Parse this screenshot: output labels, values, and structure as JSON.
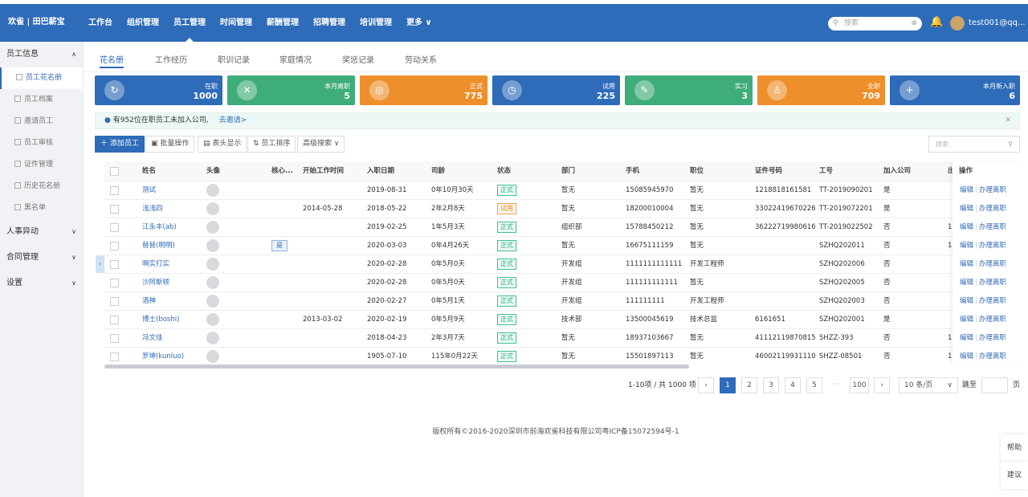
{
  "header": {
    "logo": "欢雀 | 田巴薪宝",
    "nav": [
      "工作台",
      "组织管理",
      "员工管理",
      "时间管理",
      "薪酬管理",
      "招聘管理",
      "培训管理",
      "更多"
    ],
    "search_placeholder": "搜索",
    "user": "test001@qq..."
  },
  "sidebar": {
    "groups": [
      {
        "label": "员工信息",
        "items": [
          "员工花名册",
          "员工档案",
          "邀请员工",
          "员工审核",
          "证件管理",
          "历史花名册",
          "黑名单"
        ]
      },
      {
        "label": "人事异动"
      },
      {
        "label": "合同管理"
      },
      {
        "label": "设置"
      }
    ]
  },
  "tabs": [
    "花名册",
    "工作经历",
    "职训记录",
    "家庭情况",
    "奖惩记录",
    "劳动关系"
  ],
  "cards": [
    {
      "label": "在职",
      "value": "1000",
      "color": "#2e6bb8",
      "icon": "↻"
    },
    {
      "label": "本月离职",
      "value": "5",
      "color": "#3fad7a",
      "icon": "✕"
    },
    {
      "label": "正式",
      "value": "775",
      "color": "#ed8f2b",
      "icon": "◎"
    },
    {
      "label": "试用",
      "value": "225",
      "color": "#2e6bb8",
      "icon": "◷"
    },
    {
      "label": "实习",
      "value": "3",
      "color": "#3fad7a",
      "icon": "✎"
    },
    {
      "label": "全职",
      "value": "709",
      "color": "#ed8f2b",
      "icon": "♙"
    },
    {
      "label": "本月新入职",
      "value": "6",
      "color": "#2e6bb8",
      "icon": "+"
    }
  ],
  "notice": {
    "text": "有952位在职员工未加入公司,",
    "link": "去邀请>"
  },
  "toolbar": {
    "add": "添加员工",
    "batch": "批量操作",
    "header_display": "表头显示",
    "sort": "员工排序",
    "advanced": "高级搜索",
    "search_placeholder": "搜索"
  },
  "table": {
    "columns": [
      "姓名",
      "头像",
      "核心...",
      "开始工作时间",
      "入职日期",
      "司龄",
      "状态",
      "部门",
      "手机",
      "职位",
      "证件号码",
      "工号",
      "加入公司",
      "出",
      "操作"
    ],
    "rows": [
      {
        "name": "测试",
        "core": "",
        "start": "",
        "join": "2019-08-31",
        "tenure": "0年10月30天",
        "status": "正式",
        "dept": "暂无",
        "phone": "15085945970",
        "pos": "暂无",
        "idno": "1218818161581",
        "emp": "TT-2019090201",
        "joined": "是",
        "extra": ""
      },
      {
        "name": "浅浅四",
        "core": "",
        "start": "2014-05-28",
        "join": "2018-05-22",
        "tenure": "2年2月8天",
        "status": "试用",
        "dept": "暂无",
        "phone": "18200010004",
        "pos": "暂无",
        "idno": "33022419670226...",
        "emp": "TT-2019072201",
        "joined": "是",
        "extra": ""
      },
      {
        "name": "江永丰(ab)",
        "core": "",
        "start": "",
        "join": "2019-02-25",
        "tenure": "1年5月3天",
        "status": "正式",
        "dept": "组织部",
        "phone": "15788450212",
        "pos": "暂无",
        "idno": "36222719980616...",
        "emp": "TT-2019022502",
        "joined": "否",
        "extra": "1"
      },
      {
        "name": "替替(明明)",
        "core": "是",
        "start": "",
        "join": "2020-03-03",
        "tenure": "0年4月26天",
        "status": "正式",
        "dept": "暂无",
        "phone": "16675111159",
        "pos": "暂无",
        "idno": "",
        "emp": "SZHQ202011",
        "joined": "否",
        "extra": "1"
      },
      {
        "name": "啊实打实",
        "core": "",
        "start": "",
        "join": "2020-02-28",
        "tenure": "0年5月0天",
        "status": "正式",
        "dept": "开发组",
        "phone": "1111111111111",
        "pos": "开发工程师",
        "idno": "",
        "emp": "SZHQ202006",
        "joined": "否",
        "extra": ""
      },
      {
        "name": "沙阿斯顿",
        "core": "",
        "start": "",
        "join": "2020-02-28",
        "tenure": "0年5月0天",
        "status": "正式",
        "dept": "开发组",
        "phone": "111111111111",
        "pos": "暂无",
        "idno": "",
        "emp": "SZHQ202005",
        "joined": "否",
        "extra": ""
      },
      {
        "name": "酒神",
        "core": "",
        "start": "",
        "join": "2020-02-27",
        "tenure": "0年5月1天",
        "status": "正式",
        "dept": "开发组",
        "phone": "111111111",
        "pos": "开发工程师",
        "idno": "",
        "emp": "SZHQ202003",
        "joined": "否",
        "extra": ""
      },
      {
        "name": "博士(boshi)",
        "core": "",
        "start": "2013-03-02",
        "join": "2020-02-19",
        "tenure": "0年5月9天",
        "status": "正式",
        "dept": "技术部",
        "phone": "13500045619",
        "pos": "技术总监",
        "idno": "6161651",
        "emp": "SZHQ202001",
        "joined": "是",
        "extra": ""
      },
      {
        "name": "冯文佳",
        "core": "",
        "start": "",
        "join": "2018-04-23",
        "tenure": "2年3月7天",
        "status": "正式",
        "dept": "暂无",
        "phone": "18937103667",
        "pos": "暂无",
        "idno": "41112119870815...",
        "emp": "SHZZ-393",
        "joined": "否",
        "extra": "1"
      },
      {
        "name": "罗坤(kunluo)",
        "core": "",
        "start": "",
        "join": "1905-07-10",
        "tenure": "115年0月22天",
        "status": "正式",
        "dept": "暂无",
        "phone": "15501897113",
        "pos": "暂无",
        "idno": "46002119931110...",
        "emp": "SHZZ-08501",
        "joined": "否",
        "extra": "1"
      }
    ],
    "op_edit": "编辑",
    "op_leave": "办理离职"
  },
  "pagination": {
    "summary": "1-10项 / 共 1000 项",
    "pages": [
      "1",
      "2",
      "3",
      "4",
      "5",
      "···",
      "100"
    ],
    "size": "10 条/页",
    "goto": "跳至",
    "page_unit": "页"
  },
  "footer": "版权所有©2016-2020深圳市前海欢雀科技有限公司粤ICP备15072594号-1",
  "float": {
    "help": "帮助",
    "suggest": "建议"
  }
}
